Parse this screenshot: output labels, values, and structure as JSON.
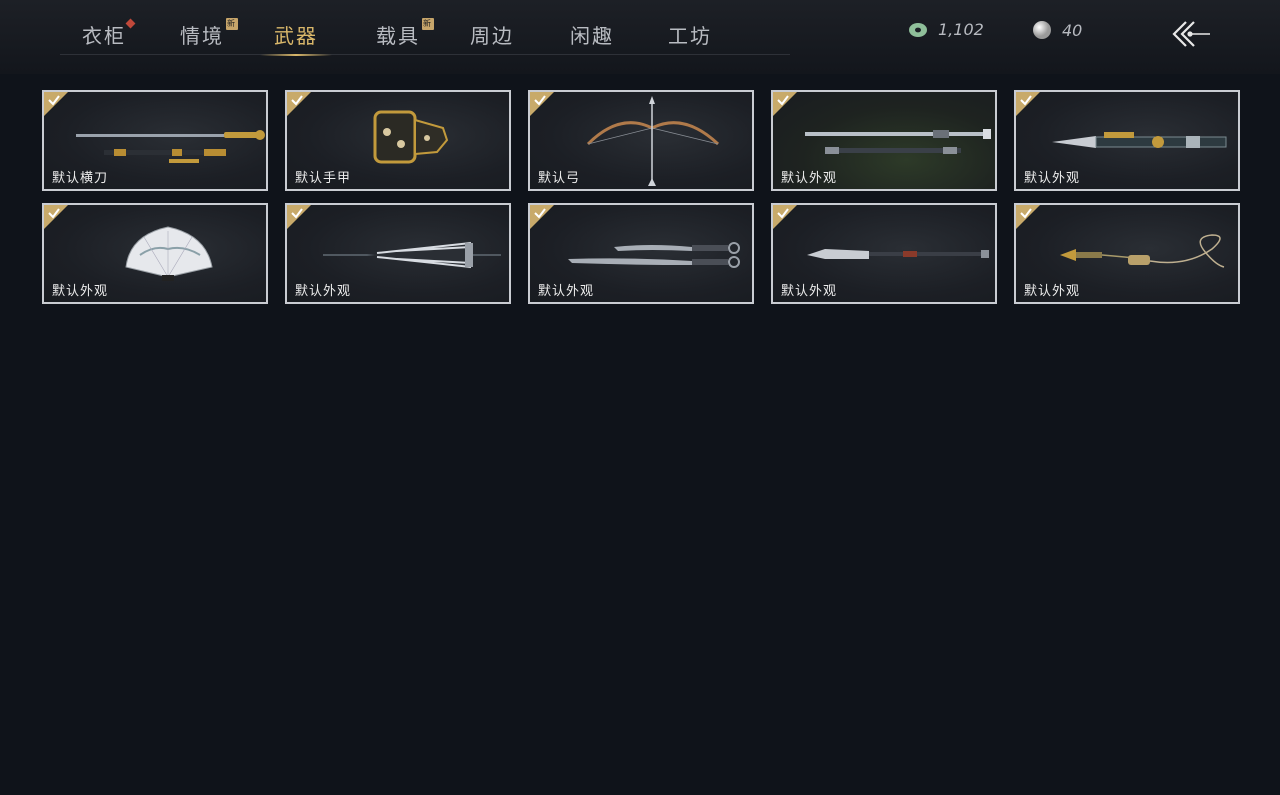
{
  "tabs": [
    {
      "label": "衣柜",
      "badge": "diamond"
    },
    {
      "label": "情境",
      "badge": "新"
    },
    {
      "label": "武器",
      "active": true
    },
    {
      "label": "载具",
      "badge": "新"
    },
    {
      "label": "周边"
    },
    {
      "label": "闲趣"
    },
    {
      "label": "工坊"
    }
  ],
  "currency": {
    "jade": {
      "icon": "jade-coin-icon",
      "value": "1,102"
    },
    "pearl": {
      "icon": "pearl-icon",
      "value": "40"
    }
  },
  "back_button": {
    "icon": "back-arrow-icon"
  },
  "items": [
    {
      "label": "默认横刀",
      "icon": "saber-icon",
      "equipped": true
    },
    {
      "label": "默认手甲",
      "icon": "gauntlet-icon",
      "equipped": true
    },
    {
      "label": "默认弓",
      "icon": "bow-icon",
      "equipped": true
    },
    {
      "label": "默认外观",
      "icon": "spear-icon",
      "equipped": true
    },
    {
      "label": "默认外观",
      "icon": "blade-staff-icon",
      "equipped": true
    },
    {
      "label": "默认外观",
      "icon": "fan-icon",
      "equipped": true
    },
    {
      "label": "默认外观",
      "icon": "umbrella-icon",
      "equipped": true
    },
    {
      "label": "默认外观",
      "icon": "twin-blades-icon",
      "equipped": true
    },
    {
      "label": "默认外观",
      "icon": "glaive-icon",
      "equipped": true
    },
    {
      "label": "默认外观",
      "icon": "rope-dart-icon",
      "equipped": true
    }
  ],
  "colors": {
    "accent": "#d9b76a",
    "check": "#c8aa6a",
    "background": "#0f131a"
  }
}
